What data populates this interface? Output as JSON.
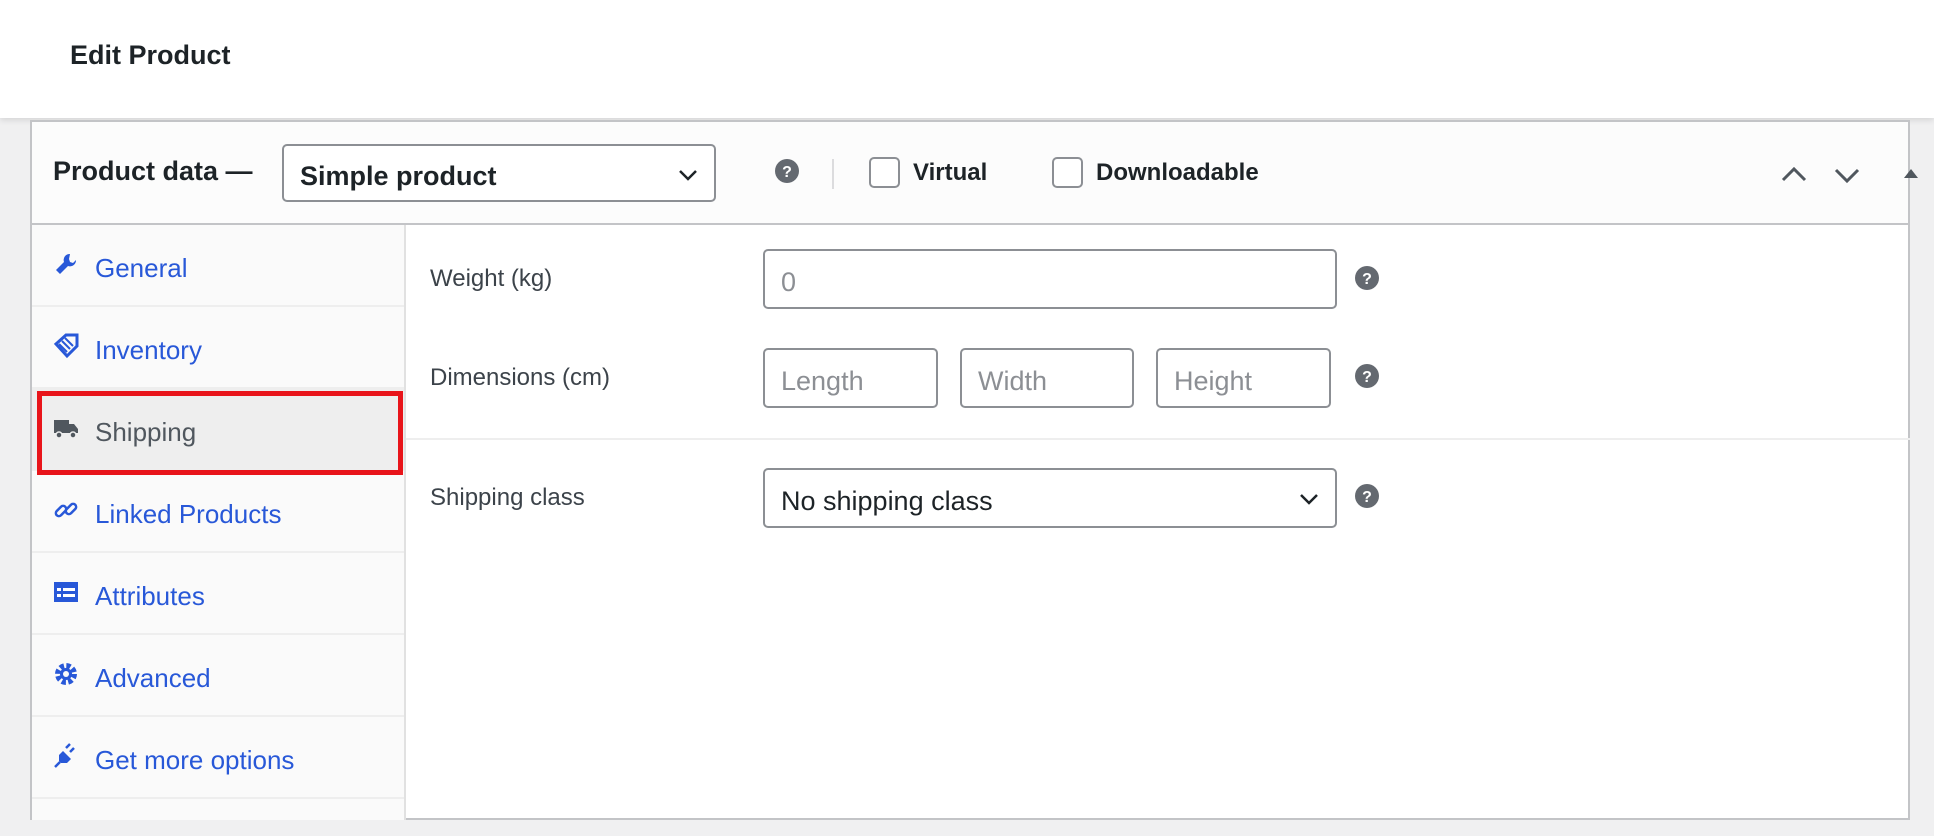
{
  "page": {
    "title": "Edit Product"
  },
  "product_data": {
    "heading": "Product data —",
    "product_type": "Simple product",
    "virtual": {
      "label": "Virtual",
      "checked": false
    },
    "downloadable": {
      "label": "Downloadable",
      "checked": false
    }
  },
  "tabs": [
    {
      "label": "General",
      "icon": "wrench-icon"
    },
    {
      "label": "Inventory",
      "icon": "tag-icon"
    },
    {
      "label": "Shipping",
      "icon": "truck-icon",
      "active": true
    },
    {
      "label": "Linked Products",
      "icon": "link-icon"
    },
    {
      "label": "Attributes",
      "icon": "list-icon"
    },
    {
      "label": "Advanced",
      "icon": "gear-icon"
    },
    {
      "label": "Get more options",
      "icon": "plug-icon"
    }
  ],
  "shipping": {
    "weight_label": "Weight (kg)",
    "weight_placeholder": "0",
    "dimensions_label": "Dimensions (cm)",
    "length_placeholder": "Length",
    "width_placeholder": "Width",
    "height_placeholder": "Height",
    "class_label": "Shipping class",
    "class_value": "No shipping class"
  },
  "colors": {
    "link": "#2858d8",
    "highlight": "#e8141a"
  }
}
